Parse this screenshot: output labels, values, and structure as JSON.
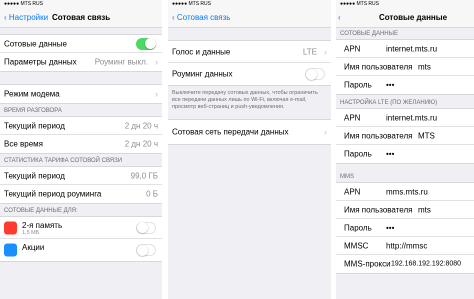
{
  "screen1": {
    "status": {
      "carrier": "●●●●● MTS RUS",
      "time": "",
      "battery": ""
    },
    "back": "Настройки",
    "title": "Сотовая связь",
    "rows_top": [
      {
        "label": "Сотовые данные",
        "toggle": "on"
      },
      {
        "label": "Параметры данных",
        "value": "Роуминг выкл."
      }
    ],
    "rows_modem": [
      {
        "label": "Режим модема"
      }
    ],
    "section_time": "ВРЕМЯ РАЗГОВОРА",
    "rows_time": [
      {
        "label": "Текущий период",
        "value": "2 дн 20 ч"
      },
      {
        "label": "Все время",
        "value": "2 дн 20 ч"
      }
    ],
    "section_stats": "СТАТИСТИКА ТАРИФА СОТОВОЙ СВЯЗИ",
    "rows_stats": [
      {
        "label": "Текущий период",
        "value": "99,0 ГБ"
      },
      {
        "label": "Текущий период роуминга",
        "value": "0 Б"
      }
    ],
    "section_apps": "СОТОВЫЕ ДАННЫЕ ДЛЯ:",
    "apps": [
      {
        "label": "2-я память",
        "sub": "1,5 МБ",
        "toggle": "off"
      },
      {
        "label": "Акции",
        "sub": "",
        "toggle": "off"
      }
    ]
  },
  "screen2": {
    "status": {
      "carrier": "●●●●● MTS RUS",
      "time": "",
      "battery": ""
    },
    "back": "Сотовая связь",
    "title": "",
    "rows_top": [
      {
        "label": "Голос и данные",
        "value": "LTE"
      },
      {
        "label": "Роуминг данных",
        "toggle": "off"
      }
    ],
    "footnote": "Выключите передачу сотовых данных, чтобы ограничить все передачи данных лишь по Wi-Fi, включая e-mail, просмотр веб-страниц и push-уведомления.",
    "rows_net": [
      {
        "label": "Сотовая сеть передачи данных"
      }
    ]
  },
  "screen3": {
    "status": {
      "carrier": "●●●●● MTS RUS",
      "time": "",
      "battery": ""
    },
    "title": "Сотовые данные",
    "section_data": "СОТОВЫЕ ДАННЫЕ",
    "rows_data": [
      {
        "label": "APN",
        "value": "internet.mts.ru"
      },
      {
        "label": "Имя пользователя",
        "value": "mts"
      },
      {
        "label": "Пароль",
        "value": "•••"
      }
    ],
    "section_lte": "НАСТРОЙКА LTE (ПО ЖЕЛАНИЮ)",
    "rows_lte": [
      {
        "label": "APN",
        "value": "internet.mts.ru"
      },
      {
        "label": "Имя пользователя",
        "value": "MTS"
      },
      {
        "label": "Пароль",
        "value": "•••"
      }
    ],
    "section_mms": "MMS",
    "rows_mms": [
      {
        "label": "APN",
        "value": "mms.mts.ru"
      },
      {
        "label": "Имя пользователя",
        "value": "mts"
      },
      {
        "label": "Пароль",
        "value": "•••"
      },
      {
        "label": "MMSC",
        "value": "http://mmsc"
      },
      {
        "label": "MMS-прокси",
        "value": "192.168.192.192:8080"
      }
    ]
  },
  "colors": {
    "accent": "#0a7aff",
    "toggle_on": "#4cd964",
    "background": "#efeff4"
  }
}
